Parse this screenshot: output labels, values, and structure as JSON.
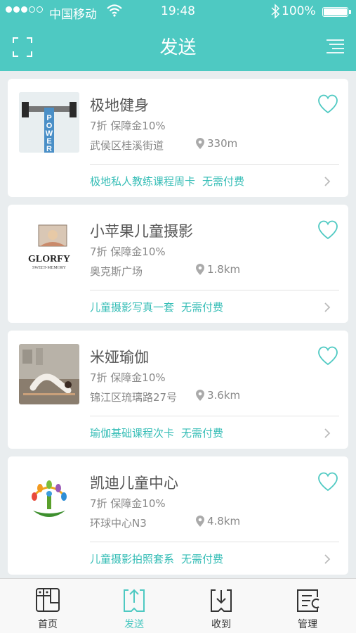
{
  "status_bar": {
    "carrier": "中国移动",
    "time": "19:48",
    "battery": "100%"
  },
  "header": {
    "title": "发送",
    "left_icon": "scan-icon",
    "right_icon": "menu-icon"
  },
  "cards": [
    {
      "name": "极地健身",
      "deal": "7折  保障金10%",
      "address": "武侯区桂溪街道",
      "distance": "330m",
      "offer": "极地私人教练课程周卡",
      "pay": "无需付费",
      "logo_text": "POWER"
    },
    {
      "name": "小苹果儿童摄影",
      "deal": "7折  保障金10%",
      "address": "奥克斯广场",
      "distance": "1.8km",
      "offer": "儿童摄影写真一套",
      "pay": "无需付费",
      "logo_text": "GLORFY",
      "logo_sub": "SWEET-MEMORY"
    },
    {
      "name": "米娅瑜伽",
      "deal": "7折  保障金10%",
      "address": "锦江区琉璃路27号",
      "distance": "3.6km",
      "offer": "瑜伽基础课程次卡",
      "pay": "无需付费"
    },
    {
      "name": "凯迪儿童中心",
      "deal": "7折  保障金10%",
      "address": "环球中心N3",
      "distance": "4.8km",
      "offer": "儿童摄影拍照套系",
      "pay": "无需付费"
    }
  ],
  "tabs": [
    {
      "label": "首页",
      "icon": "home-grid-icon"
    },
    {
      "label": "发送",
      "icon": "send-upload-icon",
      "active": true
    },
    {
      "label": "收到",
      "icon": "receive-download-icon"
    },
    {
      "label": "管理",
      "icon": "manage-list-icon"
    }
  ],
  "colors": {
    "accent": "#4ec9c2",
    "link": "#35bdb6"
  }
}
